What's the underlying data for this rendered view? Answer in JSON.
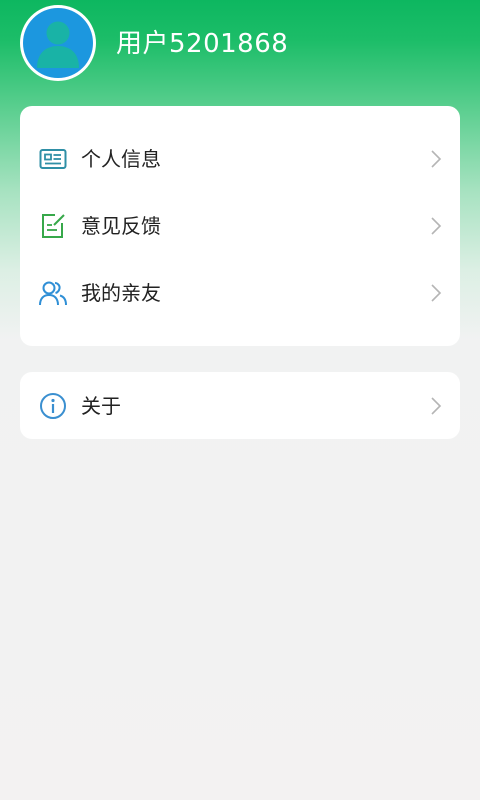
{
  "header": {
    "username": "用户5201868",
    "avatar_icon": "user-avatar-icon"
  },
  "menu": {
    "items": [
      {
        "label": "个人信息",
        "icon": "id-card-icon",
        "icon_color": "#2f8fa6"
      },
      {
        "label": "意见反馈",
        "icon": "feedback-edit-icon",
        "icon_color": "#37a84a"
      },
      {
        "label": "我的亲友",
        "icon": "contacts-icon",
        "icon_color": "#2f8fd6"
      }
    ],
    "about": {
      "label": "关于",
      "icon": "info-icon",
      "icon_color": "#3a8fd0"
    }
  },
  "colors": {
    "header_green": "#0db760",
    "background": "#f3f2f2",
    "card": "#ffffff",
    "chevron": "#b5b5b5"
  }
}
